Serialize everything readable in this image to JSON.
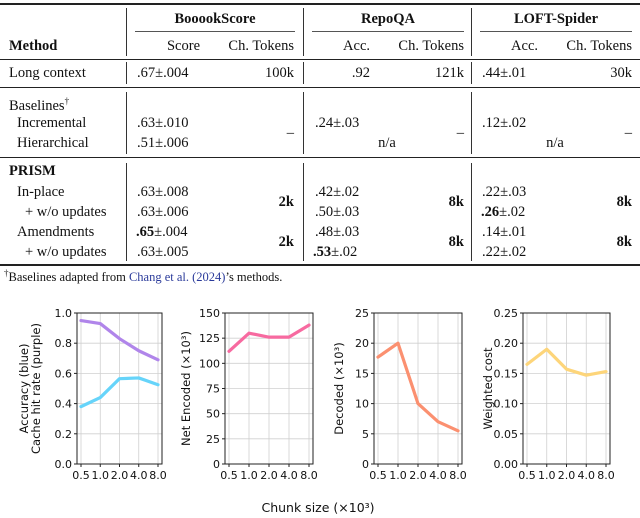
{
  "table": {
    "group_headers": [
      "BooookScore",
      "RepoQA",
      "LOFT-Spider"
    ],
    "method_header": "Method",
    "sub_headers": [
      "Score",
      "Ch. Tokens",
      "Acc.",
      "Ch. Tokens",
      "Acc.",
      "Ch. Tokens"
    ],
    "rows": {
      "long_context": {
        "label": "Long context",
        "cells": [
          ".67±.004",
          "100k",
          ".92",
          "121k",
          ".44±.01",
          "30k"
        ]
      },
      "baselines_label": "Baselines",
      "baselines_mark": "†",
      "incremental": {
        "label": "Incremental",
        "cells": [
          ".63±.010",
          ".24±.03",
          ".12±.02"
        ]
      },
      "hierarchical": {
        "label": "Hierarchical",
        "cells": [
          ".51±.006",
          "n/a",
          "n/a"
        ]
      },
      "baseline_tokens": [
        "–",
        "–",
        "–"
      ],
      "prism_label": "PRISM",
      "inplace": {
        "label": "In-place",
        "cells": [
          ".63±.008",
          ".42±.02",
          ".22±.03"
        ]
      },
      "inplace_wo": {
        "label": "+ w/o updates",
        "cells": [
          ".63±.006",
          ".50±.03",
          ".26",
          "±.02"
        ]
      },
      "amend": {
        "label": "Amendments",
        "cells": [
          ".65",
          "±.004",
          ".48±.03",
          ".14±.01"
        ]
      },
      "amend_wo": {
        "label": "+ w/o updates",
        "cells": [
          ".63±.005",
          ".53",
          "±.02",
          ".22±.02"
        ]
      },
      "inplace_tokens": [
        "2k",
        "8k",
        "8k"
      ],
      "amend_tokens": [
        "2k",
        "8k",
        "8k"
      ]
    },
    "footnote": {
      "mark": "†",
      "pre": "Baselines adapted from ",
      "link": "Chang et al. (2024)",
      "post": "’s methods."
    }
  },
  "chart_data": [
    {
      "type": "line",
      "title": "",
      "xlabel": "",
      "ylabel": "Accuracy (blue)\nCache hit rate (purple)",
      "ylabel_lines": [
        "Accuracy (blue)",
        "Cache hit rate (purple)"
      ],
      "categories": [
        "0.5",
        "1.0",
        "2.0",
        "4.0",
        "8.0"
      ],
      "ylim": [
        0,
        1.0
      ],
      "yticks": [
        0.0,
        0.2,
        0.4,
        0.6,
        0.8,
        1.0
      ],
      "ytick_labels": [
        "0.0",
        "0.2",
        "0.4",
        "0.6",
        "0.8",
        "1.0"
      ],
      "grid": true,
      "series": [
        {
          "name": "Cache hit rate",
          "color": "#b085ea",
          "values": [
            0.95,
            0.93,
            0.83,
            0.75,
            0.69
          ]
        },
        {
          "name": "Accuracy",
          "color": "#66d4fa",
          "values": [
            0.38,
            0.44,
            0.565,
            0.57,
            0.525
          ]
        }
      ]
    },
    {
      "type": "line",
      "ylabel": "Net Encoded (×10³)",
      "categories": [
        "0.5",
        "1.0",
        "2.0",
        "4.0",
        "8.0"
      ],
      "ylim": [
        0,
        150
      ],
      "yticks": [
        0,
        25,
        50,
        75,
        100,
        125,
        150
      ],
      "ytick_labels": [
        "0",
        "25",
        "50",
        "75",
        "100",
        "125",
        "150"
      ],
      "grid": true,
      "series": [
        {
          "name": "Net Encoded",
          "color": "#f76aa0",
          "values": [
            112,
            130,
            126,
            126,
            138
          ]
        }
      ]
    },
    {
      "type": "line",
      "ylabel": "Decoded (×10³)",
      "categories": [
        "0.5",
        "1.0",
        "2.0",
        "4.0",
        "8.0"
      ],
      "ylim": [
        0,
        25
      ],
      "yticks": [
        0,
        5,
        10,
        15,
        20,
        25
      ],
      "ytick_labels": [
        "0",
        "5",
        "10",
        "15",
        "20",
        "25"
      ],
      "grid": true,
      "series": [
        {
          "name": "Decoded",
          "color": "#fb9070",
          "values": [
            17.7,
            20,
            10,
            7,
            5.5
          ]
        }
      ]
    },
    {
      "type": "line",
      "ylabel": "Weighted cost",
      "categories": [
        "0.5",
        "1.0",
        "2.0",
        "4.0",
        "8.0"
      ],
      "ylim": [
        0,
        0.25
      ],
      "yticks": [
        0,
        0.05,
        0.1,
        0.15,
        0.2,
        0.25
      ],
      "ytick_labels": [
        "0.00",
        "0.05",
        "0.10",
        "0.15",
        "0.20",
        "0.25"
      ],
      "grid": true,
      "series": [
        {
          "name": "Weighted cost",
          "color": "#fdd57a",
          "values": [
            0.165,
            0.19,
            0.157,
            0.147,
            0.153
          ]
        }
      ]
    }
  ],
  "shared_xlabel": "Chunk size (×10³)"
}
